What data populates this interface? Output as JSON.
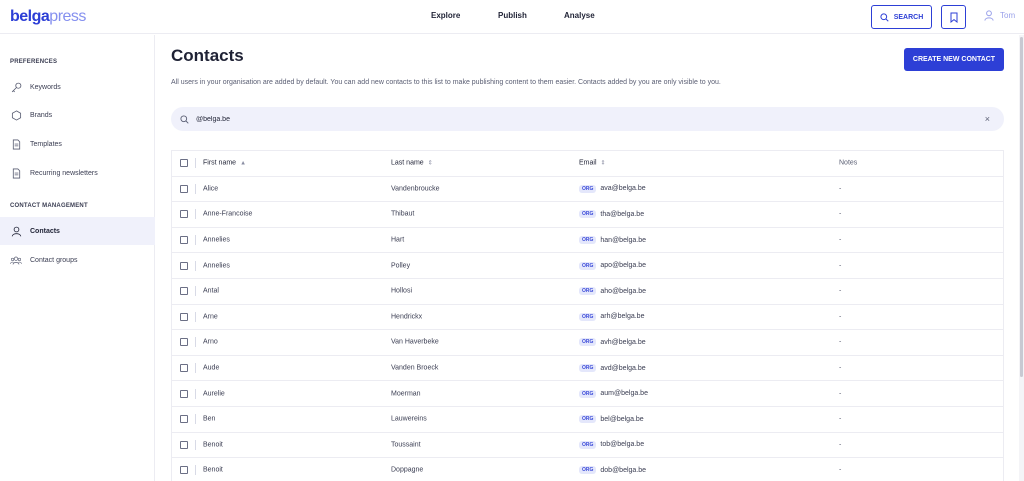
{
  "brand": {
    "part1": "belga",
    "part2": "press"
  },
  "nav": {
    "explore": "Explore",
    "publish": "Publish",
    "analyse": "Analyse"
  },
  "header": {
    "search_label": "SEARCH",
    "user_name": "Tom"
  },
  "sidebar": {
    "preferences_title": "PREFERENCES",
    "preferences_items": [
      {
        "label": "Keywords",
        "icon": "key-icon"
      },
      {
        "label": "Brands",
        "icon": "hexagon-icon"
      },
      {
        "label": "Templates",
        "icon": "document-icon"
      },
      {
        "label": "Recurring newsletters",
        "icon": "document-icon"
      }
    ],
    "contact_title": "CONTACT MANAGEMENT",
    "contact_items": [
      {
        "label": "Contacts",
        "icon": "person-icon",
        "active": true
      },
      {
        "label": "Contact groups",
        "icon": "people-icon",
        "active": false
      }
    ]
  },
  "main": {
    "title": "Contacts",
    "create_button": "CREATE NEW CONTACT",
    "description": "All users in your organisation are added by default. You can add new contacts to this list to make publishing content to them easier. Contacts added by you are only visible to you.",
    "search_value": "@belga.be"
  },
  "table": {
    "columns": {
      "first_name": "First name",
      "last_name": "Last name",
      "email": "Email",
      "notes": "Notes"
    },
    "org_badge": "ORG",
    "rows": [
      {
        "first": "Alice",
        "last": "Vandenbroucke",
        "email": "ava@belga.be",
        "notes": "-"
      },
      {
        "first": "Anne-Francoise",
        "last": "Thibaut",
        "email": "tha@belga.be",
        "notes": "-"
      },
      {
        "first": "Annelies",
        "last": "Hart",
        "email": "han@belga.be",
        "notes": "-"
      },
      {
        "first": "Annelies",
        "last": "Polley",
        "email": "apo@belga.be",
        "notes": "-"
      },
      {
        "first": "Antal",
        "last": "Hollosi",
        "email": "aho@belga.be",
        "notes": "-"
      },
      {
        "first": "Arne",
        "last": "Hendrickx",
        "email": "arh@belga.be",
        "notes": "-"
      },
      {
        "first": "Arno",
        "last": "Van Haverbeke",
        "email": "avh@belga.be",
        "notes": "-"
      },
      {
        "first": "Aude",
        "last": "Vanden Broeck",
        "email": "avd@belga.be",
        "notes": "-"
      },
      {
        "first": "Aurelie",
        "last": "Moerman",
        "email": "aum@belga.be",
        "notes": "-"
      },
      {
        "first": "Ben",
        "last": "Lauwereins",
        "email": "bel@belga.be",
        "notes": "-"
      },
      {
        "first": "Benoit",
        "last": "Toussaint",
        "email": "tob@belga.be",
        "notes": "-"
      },
      {
        "first": "Benoit",
        "last": "Doppagne",
        "email": "dob@belga.be",
        "notes": "-"
      }
    ]
  },
  "colors": {
    "accent": "#2d3fd6",
    "active_bg": "#f0f1fb",
    "badge_bg": "#e4e7fb"
  }
}
